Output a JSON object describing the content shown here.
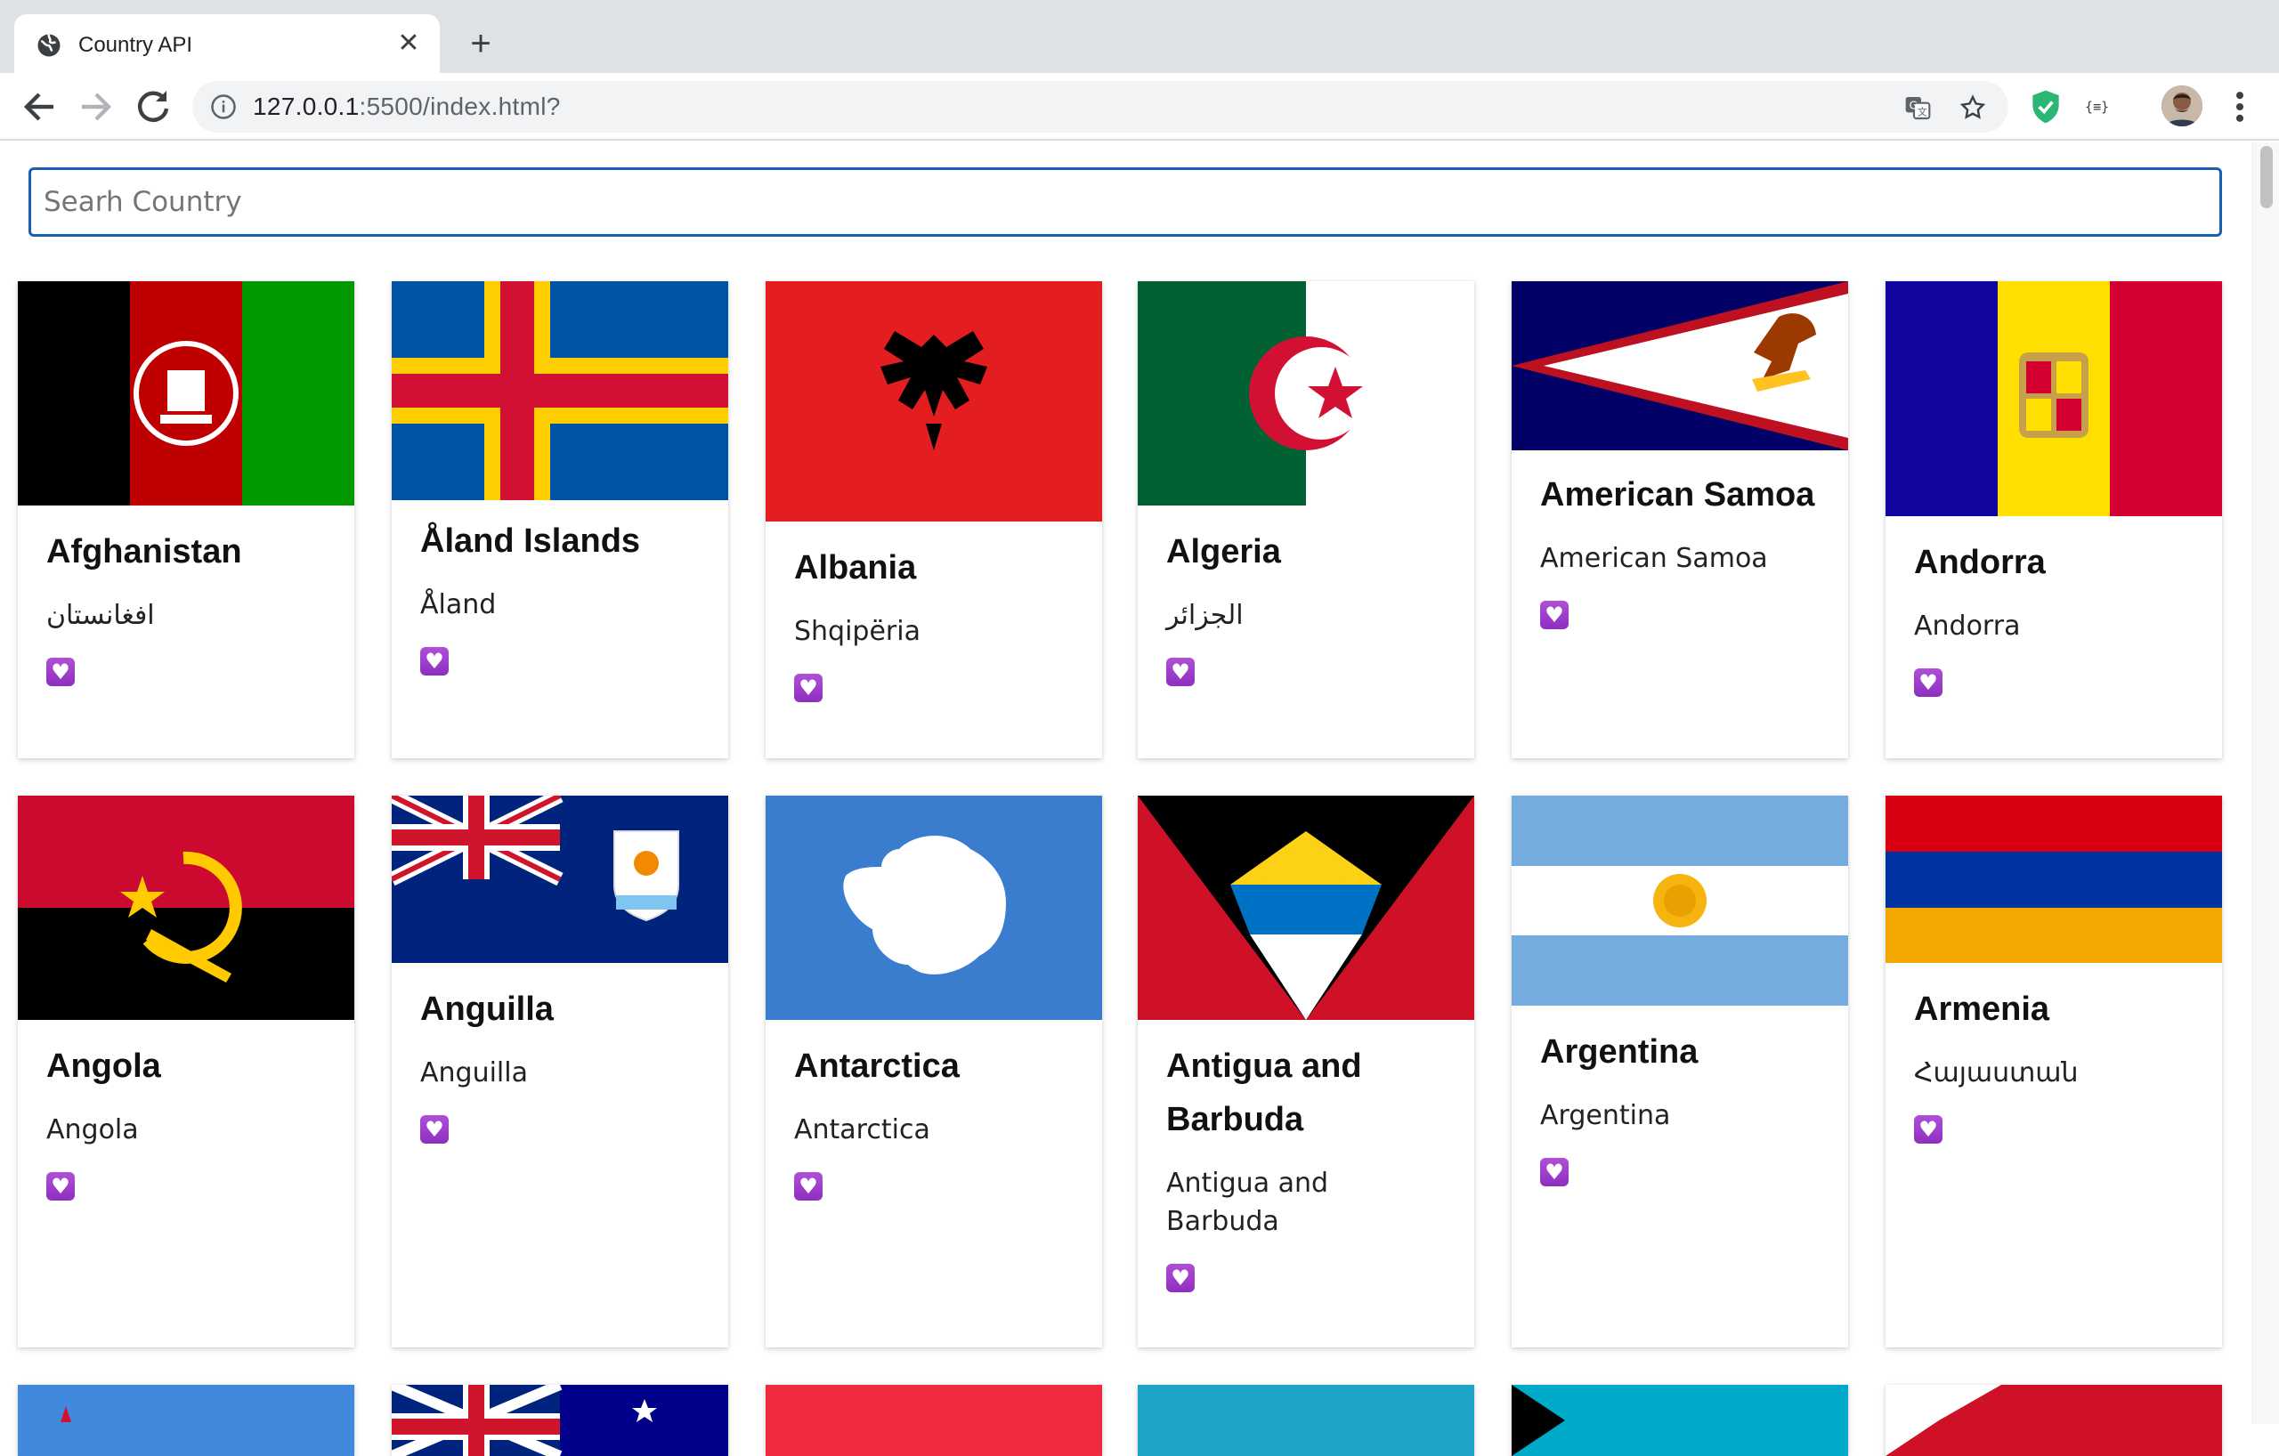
{
  "browser": {
    "tab_title": "Country API",
    "url_host": "127.0.0.1",
    "url_rest": ":5500/index.html?"
  },
  "search": {
    "placeholder": "Searh Country",
    "value": ""
  },
  "countries": [
    {
      "name": "Afghanistan",
      "native": "افغانستان"
    },
    {
      "name": "Åland Islands",
      "native": "Åland"
    },
    {
      "name": "Albania",
      "native": "Shqipëria"
    },
    {
      "name": "Algeria",
      "native": "الجزائر"
    },
    {
      "name": "American Samoa",
      "native": "American Samoa"
    },
    {
      "name": "Andorra",
      "native": "Andorra"
    },
    {
      "name": "Angola",
      "native": "Angola"
    },
    {
      "name": "Anguilla",
      "native": "Anguilla"
    },
    {
      "name": "Antarctica",
      "native": "Antarctica"
    },
    {
      "name": "Antigua and Barbuda",
      "native": "Antigua and Barbuda"
    },
    {
      "name": "Argentina",
      "native": "Argentina"
    },
    {
      "name": "Armenia",
      "native": "Հայաստան"
    }
  ],
  "icons": {
    "favorite": "heart-icon",
    "colors": {
      "heart": "#9b3fcf",
      "search_border": "#1a5fb4"
    }
  }
}
